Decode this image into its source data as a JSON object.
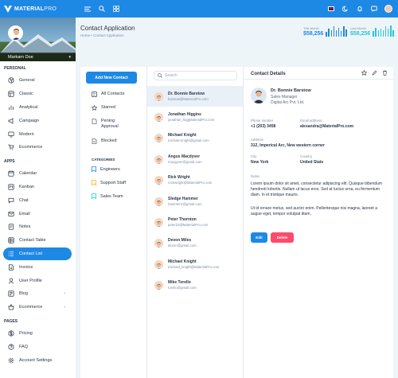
{
  "topbar": {
    "brand_main": "MATERIAL",
    "brand_sub": "PRO",
    "icons": [
      "menu-icon",
      "search-icon",
      "apps-icon"
    ],
    "right_icons": [
      "flag-uk-icon",
      "moon-icon",
      "bell-icon",
      "chat-icon",
      "avatar"
    ]
  },
  "colors": {
    "primary": "#1e88e5",
    "cyan": "#26c6da",
    "danger": "#fc4b6c"
  },
  "sidebar": {
    "user_name": "Markarn Doe",
    "sections": [
      {
        "caption": "PERSONAL",
        "items": [
          {
            "label": "General",
            "icon": "aperture-icon"
          },
          {
            "label": "Classic",
            "icon": "layout-icon"
          },
          {
            "label": "Analytical",
            "icon": "chart-bar-icon"
          },
          {
            "label": "Campaign",
            "icon": "campaign-icon"
          },
          {
            "label": "Modern",
            "icon": "monitor-icon"
          },
          {
            "label": "Ecommerce",
            "icon": "cart-icon"
          }
        ]
      },
      {
        "caption": "APPS",
        "items": [
          {
            "label": "Calendar",
            "icon": "calendar-icon"
          },
          {
            "label": "Kanban",
            "icon": "kanban-icon"
          },
          {
            "label": "Chat",
            "icon": "message-icon"
          },
          {
            "label": "Email",
            "icon": "mail-icon"
          },
          {
            "label": "Notes",
            "icon": "notes-icon"
          },
          {
            "label": "Contact Table",
            "icon": "table-icon"
          },
          {
            "label": "Contact List",
            "icon": "list-icon",
            "active": true
          },
          {
            "label": "Invoice",
            "icon": "file-icon"
          },
          {
            "label": "User Profile",
            "icon": "user-icon"
          },
          {
            "label": "Blog",
            "icon": "blog-icon",
            "chevron": true
          },
          {
            "label": "Ecommerce",
            "icon": "basket-icon",
            "chevron": true
          }
        ]
      },
      {
        "caption": "PAGES",
        "items": [
          {
            "label": "Pricing",
            "icon": "currency-icon"
          },
          {
            "label": "FAQ",
            "icon": "help-icon"
          },
          {
            "label": "Account Settings",
            "icon": "settings-icon"
          }
        ]
      }
    ]
  },
  "header": {
    "title": "Contact Application",
    "breadcrumb": "Home  •  Contact Application",
    "kpis": [
      {
        "label": "This Month",
        "value": "$58,256",
        "bars": [
          0.45,
          0.7,
          0.55,
          0.9,
          0.6,
          0.8,
          0.5,
          0.95,
          0.65
        ]
      },
      {
        "label": "Last Month",
        "value": "$58,256",
        "bars": [
          0.5,
          0.8,
          0.6,
          0.75,
          0.55,
          0.9,
          0.7,
          1.0,
          0.6
        ]
      }
    ]
  },
  "filters": {
    "add_button": "Add New Contact",
    "items": [
      {
        "label": "All Contacts",
        "icon": "all-contacts-icon"
      },
      {
        "label": "Starred",
        "icon": "star-icon"
      },
      {
        "label": "Pening\nApproval",
        "icon": "file-pending-icon"
      },
      {
        "label": "Blocked",
        "icon": "blocked-icon"
      }
    ],
    "categories_caption": "CATEGORIES",
    "categories": [
      {
        "label": "Engineers",
        "color": "#1e88e5"
      },
      {
        "label": "Support Staff",
        "color": "#ffae1f"
      },
      {
        "label": "Sales Team",
        "color": "#13deb9"
      }
    ]
  },
  "search": {
    "placeholder": "Search"
  },
  "contacts": [
    {
      "name": "Dr. Bonnie Barstow",
      "email": "barstow@MaterialPro.com",
      "selected": true
    },
    {
      "name": "Jonathan Higgins",
      "email": "jonathan_higgMaterialPro.com"
    },
    {
      "name": "Michael Knight",
      "email": "michale-knight@gmail.com"
    },
    {
      "name": "Angus Macdyver",
      "email": "macgyver@gmail.com"
    },
    {
      "name": "Rick Wright",
      "email": "rockwright@MaterialPro.com"
    },
    {
      "name": "Sledge Hammer",
      "email": "hammerrr@gmail.com"
    },
    {
      "name": "Peter Thornton",
      "email": "peter23@MaterialPro.com"
    },
    {
      "name": "Devon Miles",
      "email": "devon@gmail.com"
    },
    {
      "name": "Michael Knight",
      "email": "michael_knight@MaterialPro.com"
    },
    {
      "name": "Mike Torello",
      "email": "torello@gmail.com"
    }
  ],
  "details": {
    "title": "Contact Details",
    "name": "Dr. Bonnie Barstow",
    "role": "Sales Manager",
    "company": "Digital Arc Pvt. Ltd.",
    "phone_label": "Phone number",
    "phone": "+1 (203) 3458",
    "email_label": "Email address",
    "email": "alexandra@MaterialPro.com",
    "address_label": "Address",
    "address": "312, Imperical Arc, New western corner",
    "city_label": "City",
    "city": "New York",
    "country_label": "Country",
    "country": "United Stats",
    "notes_label": "Notes",
    "note1": "Lorem ipsum dolor sit amet, consectetur adipiscing elit. Quisque bibendum hendrerit lobortis. Nullam ut lacus eros. Sed at luctus urna, eu fermentum diam. In et tristique mauris.",
    "note2": "Ut id ornare metus, sed auctor enim. Pellentesque nisi magna, laoreet a augue eget, tempor volutpat diam.",
    "edit_label": "Edit",
    "delete_label": "Delete"
  }
}
